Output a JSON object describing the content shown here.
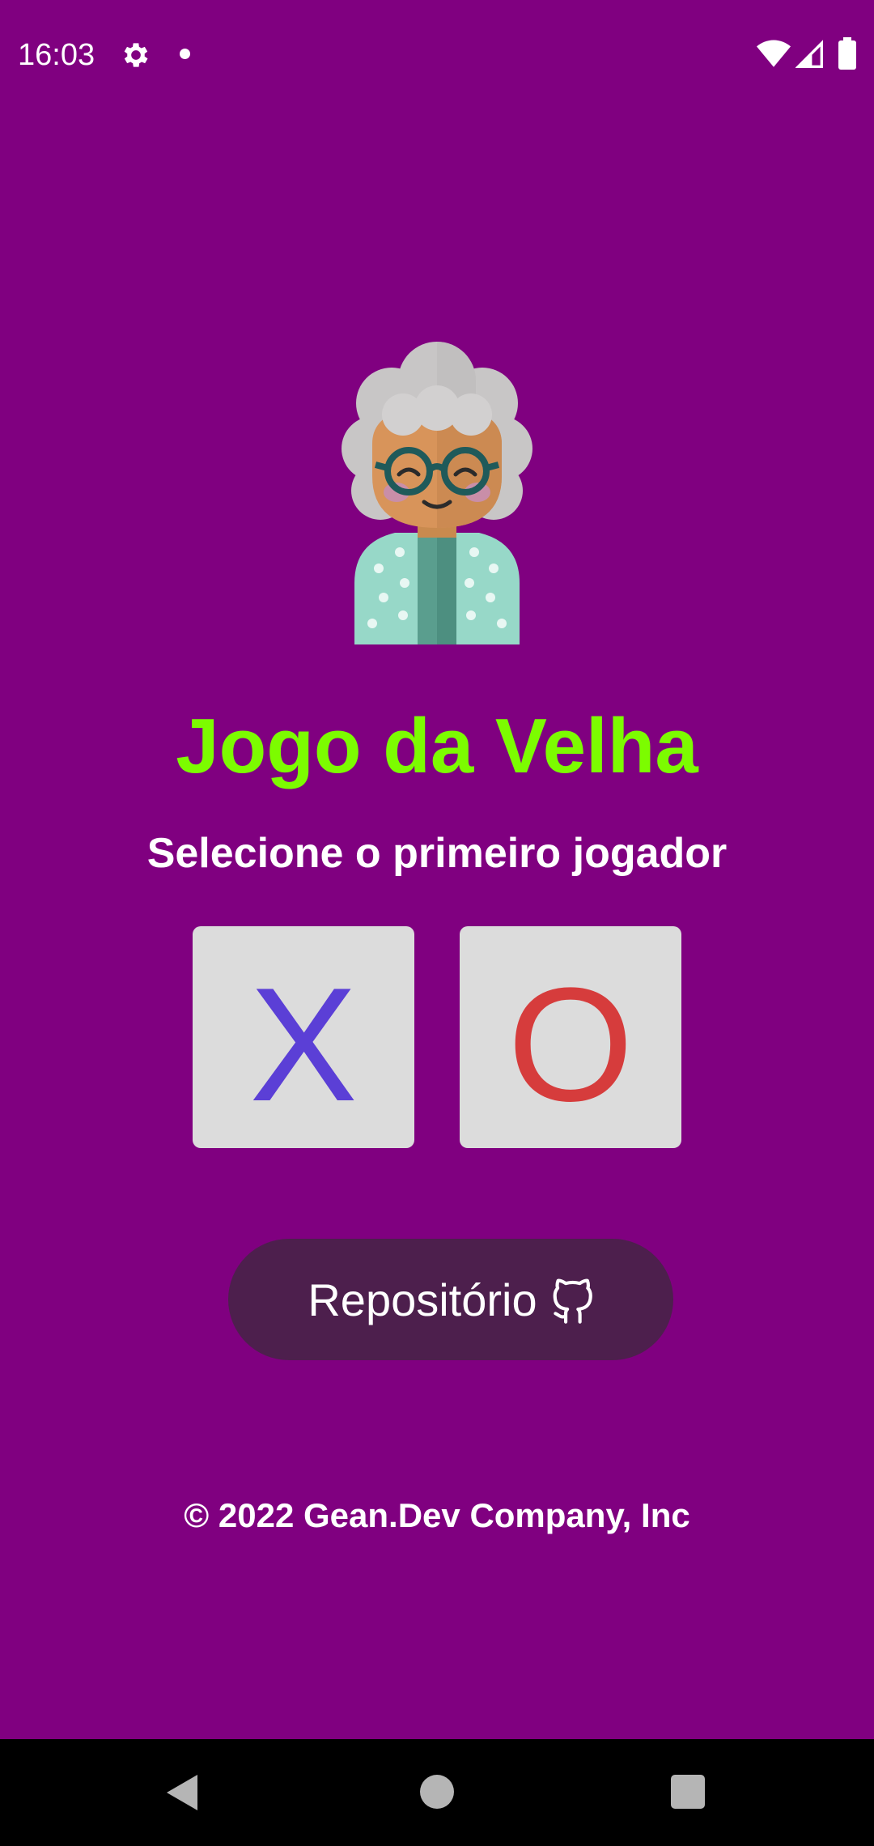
{
  "status_bar": {
    "time": "16:03",
    "icons": [
      "gear-icon",
      "notification-dot-icon",
      "wifi-icon",
      "signal-icon",
      "battery-icon"
    ]
  },
  "main": {
    "avatar_icon": "grandmother-avatar-icon",
    "title": "Jogo da Velha",
    "subtitle": "Selecione o primeiro jogador",
    "choices": [
      {
        "label": "X",
        "color": "#5b3fd6"
      },
      {
        "label": "O",
        "color": "#d63c3c"
      }
    ],
    "repo_button": {
      "label": "Repositório",
      "icon": "github-icon"
    },
    "footer": "© 2022 Gean.Dev Company, Inc"
  },
  "colors": {
    "background": "#800080",
    "title": "#7cfc00",
    "tile": "#dcdcdc",
    "button": "#4d1f4d"
  },
  "nav_bar": {
    "icons": [
      "back-icon",
      "home-icon",
      "recents-icon"
    ]
  }
}
